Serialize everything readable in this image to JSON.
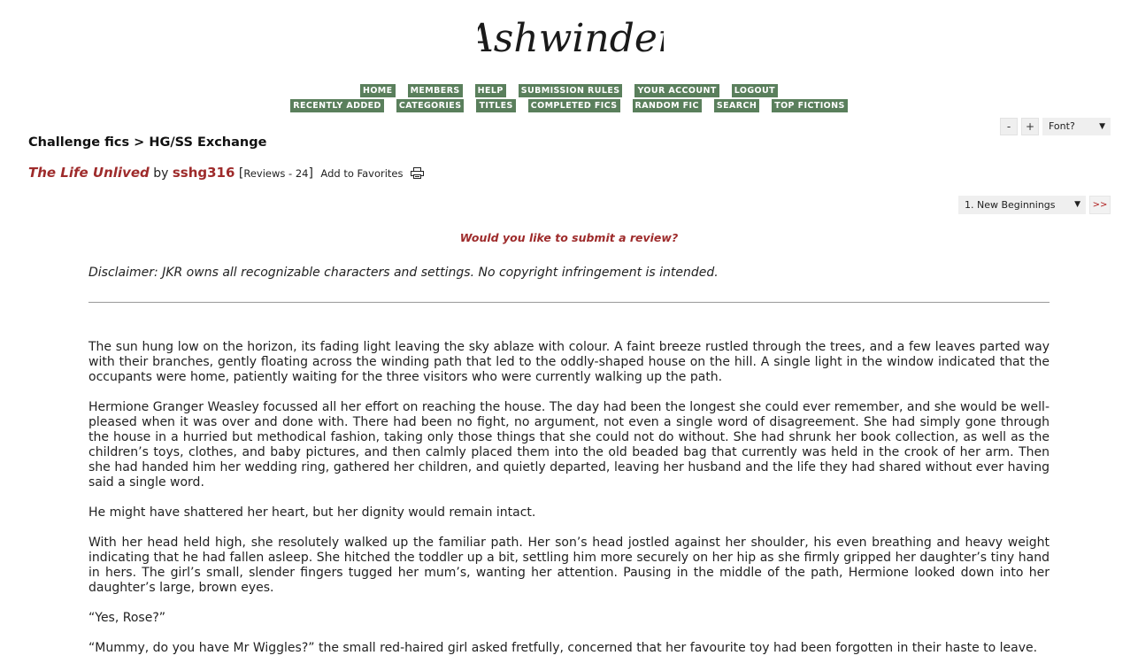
{
  "site": {
    "logo_text": "Ashwinder"
  },
  "nav": {
    "row1": [
      "HOME",
      "MEMBERS",
      "HELP",
      "SUBMISSION RULES",
      "YOUR ACCOUNT",
      "LOGOUT"
    ],
    "row2": [
      "RECENTLY ADDED",
      "CATEGORIES",
      "TITLES",
      "COMPLETED FICS",
      "RANDOM FIC",
      "SEARCH",
      "TOP FICTIONS"
    ]
  },
  "font_tools": {
    "decrease": "-",
    "increase": "+",
    "font_select": "Font?"
  },
  "breadcrumb": "Challenge fics > HG/SS Exchange",
  "story": {
    "title": "The Life Unlived",
    "by": "by",
    "author": "sshg316",
    "reviews_open": "[",
    "reviews_label": "Reviews - 24",
    "reviews_close": "]",
    "add_favorites": "Add to Favorites",
    "print_icon": "printer-icon"
  },
  "chapter_nav": {
    "selected": "1. New Beginnings",
    "next": ">>"
  },
  "review_prompt": "Would you like to submit a review?",
  "disclaimer": "Disclaimer: JKR owns all recognizable characters and settings. No copyright infringement is intended.",
  "paragraphs": [
    "The sun hung low on the horizon, its fading light leaving the sky ablaze with colour. A faint breeze rustled through the trees, and a few leaves parted way with their branches, gently floating across the winding path that led to the oddly-shaped house on the hill. A single light in the window indicated that the occupants were home, patiently waiting for the three visitors who were currently walking up the path.",
    "Hermione Granger Weasley focussed all her effort on reaching the house. The day had been the longest she could ever remember, and she would be well-pleased when it was over and done with. There had been no fight, no argument, not even a single word of disagreement. She had simply gone through the house in a hurried but methodical fashion, taking only those things that she could not do without. She had shrunk her book collection, as well as the children’s toys, clothes, and baby pictures, and then calmly placed them into the old beaded bag that currently was held in the crook of her arm. Then she had handed him her wedding ring, gathered her children, and quietly departed, leaving her husband and the life they had shared without ever having said a single word.",
    "He might have shattered her heart, but her dignity would remain intact.",
    "With her head held high, she resolutely walked up the familiar path. Her son’s head jostled against her shoulder, his even breathing and heavy weight indicating that he had fallen asleep. She hitched the toddler up a bit, settling him more securely on her hip as she firmly gripped her daughter’s tiny hand in hers. The girl’s small, slender fingers tugged her mum’s, wanting her attention. Pausing in the middle of the path, Hermione looked down into her daughter’s large, brown eyes.",
    "“Yes, Rose?”",
    "“Mummy, do you have Mr Wiggles?” the small red-haired girl asked fretfully, concerned that her favourite toy had been forgotten in their haste to leave."
  ]
}
